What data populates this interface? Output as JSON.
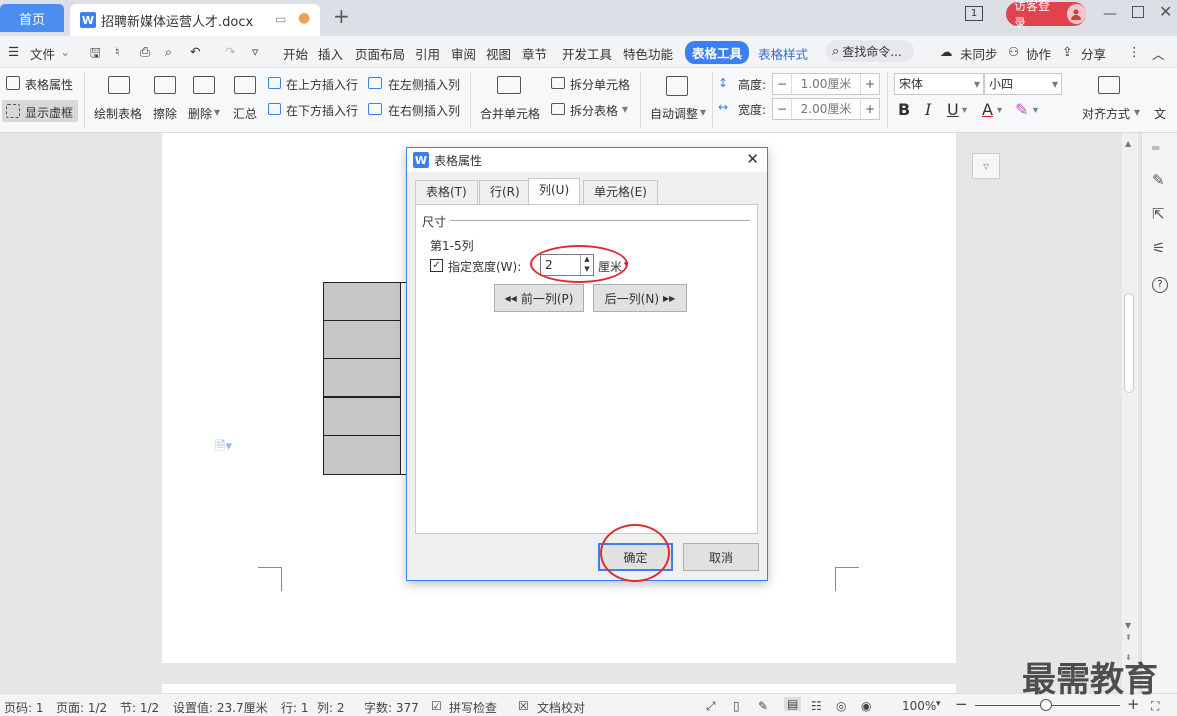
{
  "titlebar": {
    "home_tab": "首页",
    "doc_tab": "招聘新媒体运营人才.docx",
    "page_indicator": "1",
    "guest_login": "访客登录"
  },
  "menubar": {
    "file": "文件",
    "items": [
      "开始",
      "插入",
      "页面布局",
      "引用",
      "审阅",
      "视图",
      "章节",
      "开发工具",
      "特色功能"
    ],
    "table_tools": "表格工具",
    "table_style": "表格样式",
    "search": "查找命令...",
    "sync": "未同步",
    "collab": "协作",
    "share": "分享"
  },
  "ribbon": {
    "table_props": "表格属性",
    "show_grid": "显示虚框",
    "draw_table": "绘制表格",
    "erase": "擦除",
    "delete": "删除",
    "summary": "汇总",
    "insert_above": "在上方插入行",
    "insert_below": "在下方插入行",
    "insert_left": "在左侧插入列",
    "insert_right": "在右侧插入列",
    "merge_cells": "合并单元格",
    "split_cells": "拆分单元格",
    "split_table": "拆分表格",
    "auto_fit": "自动调整",
    "height_label": "高度:",
    "height_value": "1.00厘米",
    "width_label": "宽度:",
    "width_value": "2.00厘米",
    "font_name": "宋体",
    "font_size": "小四",
    "align": "对齐方式",
    "text_dir": "文"
  },
  "dialog": {
    "title": "表格属性",
    "tabs": [
      "表格(T)",
      "行(R)",
      "列(U)",
      "单元格(E)"
    ],
    "section": "尺寸",
    "column_range": "第1-5列",
    "specify_width": "指定宽度(W):",
    "width_value": "2",
    "unit": "厘米",
    "prev_col": "前一列(P)",
    "next_col": "后一列(N)",
    "ok": "确定",
    "cancel": "取消"
  },
  "status": {
    "page_num": "页码: 1",
    "pages": "页面: 1/2",
    "section": "节: 1/2",
    "setting": "设置值: 23.7厘米",
    "row": "行: 1",
    "col": "列: 2",
    "words": "字数: 377",
    "spellcheck": "拼写检查",
    "proof": "文档校对",
    "zoom": "100%"
  },
  "watermark": "最需教育",
  "colors": {
    "accent": "#3c7ff0",
    "highlight": "#e02b35"
  }
}
